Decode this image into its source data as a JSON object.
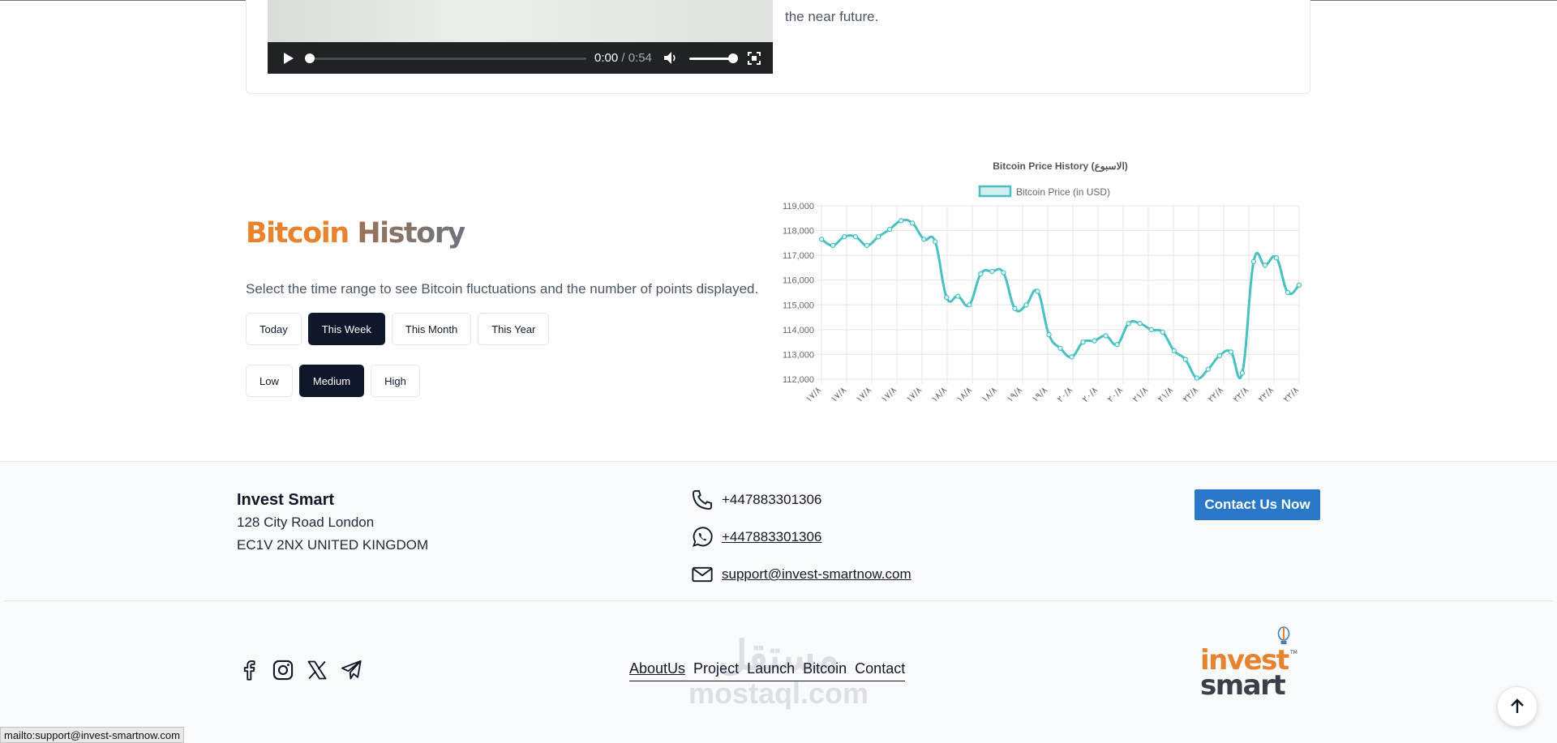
{
  "video": {
    "current_time": "0:00",
    "duration": "/ 0:54",
    "caption_fragment": "the near future."
  },
  "bitcoin": {
    "title_word1": "Bitcoin",
    "title_word2": "History",
    "description": "Select the time range to see Bitcoin fluctuations and the number of points displayed.",
    "range_buttons": [
      "Today",
      "This Week",
      "This Month",
      "This Year"
    ],
    "active_range": "This Week",
    "density_buttons": [
      "Low",
      "Medium",
      "High"
    ],
    "active_density": "Medium"
  },
  "chart_data": {
    "type": "line",
    "title": "Bitcoin Price History (الاسبوع)",
    "legend": "Bitcoin Price (in USD)",
    "legend_position": "top",
    "grid": true,
    "ylim": [
      112000,
      119000
    ],
    "y_ticks": [
      "119,000",
      "118,000",
      "117,000",
      "116,000",
      "115,000",
      "114,000",
      "113,000",
      "112,000"
    ],
    "x_tick_labels": [
      "١٧/٨",
      "١٧/٨",
      "١٧/٨",
      "١٧/٨",
      "١٧/٨",
      "١٨/٨",
      "١٨/٨",
      "١٨/٨",
      "١٩/٨",
      "١٩/٨",
      "٢٠/٨",
      "٢٠/٨",
      "٢٠/٨",
      "٢١/٨",
      "٢١/٨",
      "٢٢/٨",
      "٢٢/٨",
      "٢٢/٨",
      "٢٢/٨",
      "٢٢/٨"
    ],
    "color": "#4bc0c0",
    "series": [
      {
        "name": "Bitcoin Price (in USD)",
        "values": [
          117650,
          117400,
          117750,
          117750,
          117400,
          117750,
          118050,
          118400,
          118300,
          117650,
          117550,
          115300,
          115350,
          115000,
          116250,
          116350,
          116300,
          114850,
          115000,
          115550,
          113800,
          113250,
          112900,
          113500,
          113550,
          113750,
          113400,
          114250,
          114250,
          114000,
          113900,
          113150,
          112800,
          112050,
          112400,
          112950,
          113100,
          112250,
          116750,
          116600,
          116900,
          115500,
          115800
        ]
      }
    ]
  },
  "footer": {
    "brand": "Invest Smart",
    "address_line1": "128 City Road London",
    "address_line2": "EC1V 2NX UNITED KINGDOM",
    "phone": "+447883301306",
    "whatsapp": "+447883301306",
    "email": "support@invest-smartnow.com",
    "contact_button": "Contact Us Now",
    "nav": [
      "AboutUs",
      "Project",
      "Launch",
      "Bitcoin",
      "Contact"
    ],
    "watermark_ar": "مستقل",
    "watermark_en": "mostaql.com",
    "logo_line1": "invest",
    "logo_line2": "smart",
    "logo_tm": "TM"
  },
  "status_bar": "mailto:support@invest-smartnow.com"
}
